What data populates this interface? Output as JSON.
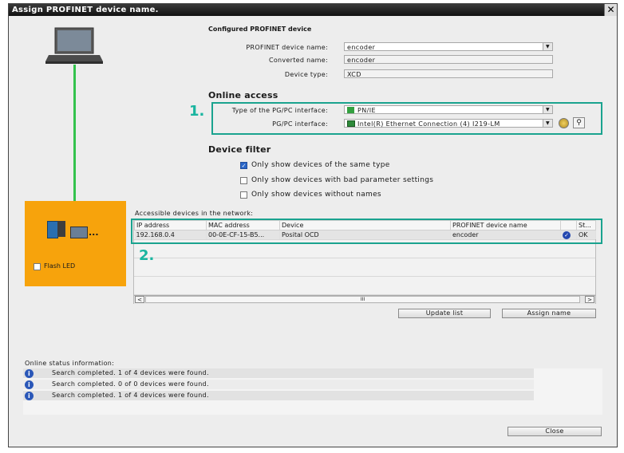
{
  "window": {
    "title": "Assign PROFINET device name.",
    "close_glyph": "✕"
  },
  "configured": {
    "heading": "Configured PROFINET device",
    "device_name_label": "PROFINET device name:",
    "device_name_value": "encoder",
    "converted_name_label": "Converted name:",
    "converted_name_value": "encoder",
    "device_type_label": "Device type:",
    "device_type_value": "XCD"
  },
  "online_access": {
    "heading": "Online access",
    "marker": "1.",
    "interface_type_label": "Type of the PG/PC interface:",
    "interface_type_value": "PN/IE",
    "interface_label": "PG/PC interface:",
    "interface_value": "Intel(R) Ethernet Connection (4) I219-LM"
  },
  "device_filter": {
    "heading": "Device filter",
    "options": [
      {
        "label": "Only show devices of the same type",
        "checked": true
      },
      {
        "label": "Only show devices with bad parameter settings",
        "checked": false
      },
      {
        "label": "Only show devices without names",
        "checked": false
      }
    ]
  },
  "left_panel": {
    "flash_led_label": "Flash LED",
    "device_dots": "...",
    "colors": {
      "panel": "#f7a30c",
      "link": "#33c24d"
    }
  },
  "devices": {
    "heading": "Accessible devices in the network:",
    "marker": "2.",
    "columns": [
      "IP address",
      "MAC address",
      "Device",
      "PROFINET device name",
      "",
      "St..."
    ],
    "rows": [
      {
        "ip": "192.168.0.4",
        "mac": "00-0E-CF-15-B5...",
        "device": "Posital OCD",
        "name": "encoder",
        "status_icon": "check-circle-icon",
        "status": "OK"
      }
    ],
    "scroll_center": "III",
    "scroll_left": "<",
    "scroll_right": ">",
    "update_button": "Update list",
    "assign_button": "Assign name"
  },
  "status": {
    "heading": "Online status information:",
    "messages": [
      "Search completed. 1 of 4 devices were found.",
      "Search completed. 0 of 0 devices were found.",
      "Search completed. 1 of 4 devices were found."
    ]
  },
  "footer": {
    "close_button": "Close"
  },
  "accent_color": "#1aa38f"
}
